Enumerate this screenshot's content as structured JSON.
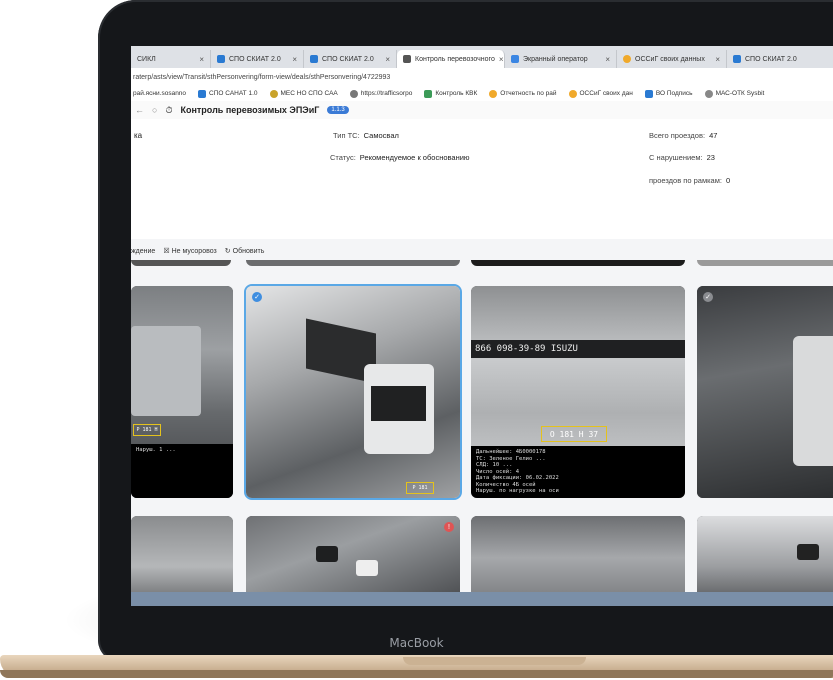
{
  "device": {
    "label": "MacBook"
  },
  "browser": {
    "tabs": [
      {
        "label": "СИКЛ",
        "favicon": "generic",
        "active": false
      },
      {
        "label": "СПО СКИАТ 2.0",
        "favicon": "spo",
        "active": false
      },
      {
        "label": "СПО СКИАТ 2.0",
        "favicon": "spo",
        "active": false
      },
      {
        "label": "Контроль перевозочного",
        "favicon": "control",
        "active": true
      },
      {
        "label": "Экранный оператор",
        "favicon": "blue",
        "active": false
      },
      {
        "label": "ОССиГ своих данных",
        "favicon": "orange",
        "active": false
      },
      {
        "label": "СПО СКИАТ 2.0",
        "favicon": "spo",
        "active": false
      }
    ],
    "url": "raterp/asts/view/Transit/sthPersonvering/form-view/deals/sthPersonvering/4722993",
    "bookmarks": [
      "рай.ясни.sosanno",
      "СПО САНАТ 1.0",
      "МЕС НО СПО САА",
      "https://trafficsorpo",
      "Контроль КВК",
      "Отчетность по рай",
      "ОССиГ своих дан",
      "ВО Подпись",
      "МАС-ОТК Sysbit"
    ],
    "app_title": "Контроль перевозимых ЭПЭиГ",
    "app_badge": "1.1.3"
  },
  "info": {
    "title": "ка",
    "vehicle_type_label": "Тип ТС:",
    "vehicle_type_value": "Самосвал",
    "status_label": "Статус:",
    "status_value": "Рекомендуемое к обоснованию",
    "total_passes_label": "Всего проездов:",
    "total_passes_value": "47",
    "with_violations_label": "С нарушением:",
    "with_violations_value": "23",
    "through_frames_label": "проездов по рамкам:",
    "through_frames_value": "0"
  },
  "toolbar": {
    "item1": "ждение",
    "item2": "Не мусоровоз",
    "item3": "Обновить"
  },
  "cards": [
    {
      "plate": "Р 181 Н",
      "caption": "Наруш. 1 ..."
    },
    {
      "plate": "Р 181",
      "caption": ""
    },
    {
      "plate": "О 181 Н 37",
      "header_text": "866 098-39-89    ISUZU",
      "caption": "Дальнейшее: 4Б0000178\nТС: Зеленое Гелио ...\nСЛД: 10 ...\nЧисло осей: 4\nДата фиксации: 06.02.2022\nКоличество 4Б осей\nНаруш. по нагрузке на оси"
    },
    {
      "plate": "",
      "caption": ""
    }
  ]
}
